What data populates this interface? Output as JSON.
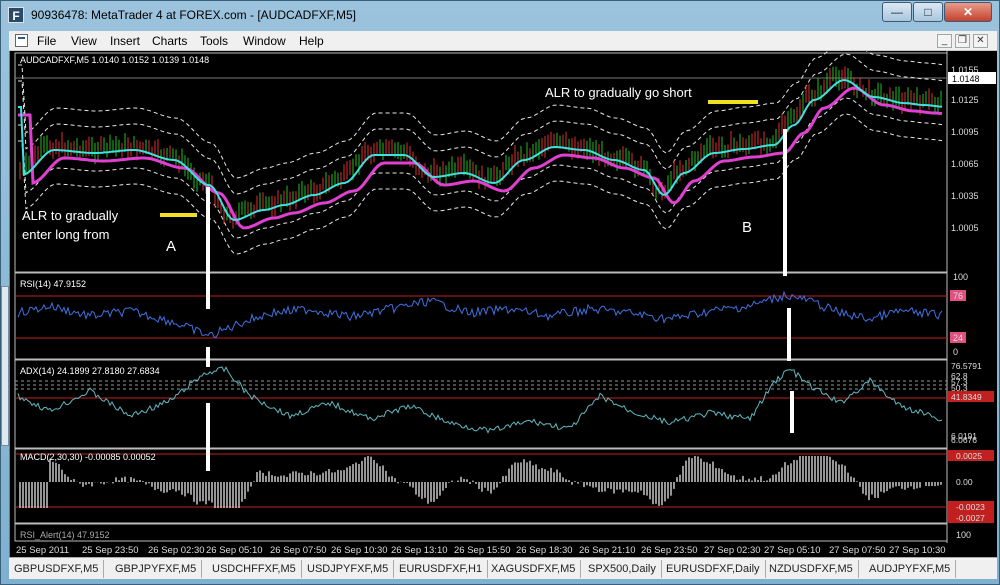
{
  "window": {
    "title": "90936478: MetaTrader 4 at FOREX.com - [AUDCADFXF,M5]",
    "app_icon_glyph": "F",
    "minimize_glyph": "—",
    "maximize_glyph": "□",
    "close_glyph": "✕"
  },
  "menu": {
    "items": [
      "File",
      "View",
      "Insert",
      "Charts",
      "Tools",
      "Window",
      "Help"
    ],
    "mdi_minimize": "_",
    "mdi_restore": "❐",
    "mdi_close": "✕"
  },
  "chart": {
    "main_header": "AUDCADFXF,M5  1.0140 1.0152 1.0139 1.0148",
    "current_price_label": "1.0148",
    "price_ticks": [
      "1.0155",
      "1.0125",
      "1.0095",
      "1.0065",
      "1.0035",
      "1.0005"
    ],
    "annotations": {
      "long_text_1": "ALR to gradually",
      "long_text_2": "enter long from",
      "short_text": "ALR to gradually go short",
      "label_a": "A",
      "label_b": "B"
    },
    "rsi": {
      "header": "RSI(14) 47.9152",
      "ticks": [
        "100",
        "76",
        "24",
        "0"
      ]
    },
    "adx": {
      "header": "ADX(14) 24.1899 27.8180 27.6834",
      "ticks": [
        "76.5791",
        "62.8",
        "57.3",
        "50.3",
        "41.8349",
        "6.0191",
        "6.0676"
      ]
    },
    "macd": {
      "header": "MACD(2,30,30) -0.00085 0.00052",
      "ticks": [
        "0.0025",
        "0.00",
        "-0.0023",
        "-0.0027"
      ]
    },
    "bottom_indicator": {
      "header": "RSI_Alert(14) 47.9152",
      "tick": "100"
    },
    "time_labels": [
      "25 Sep 2011",
      "25 Sep 23:50",
      "26 Sep 02:30",
      "26 Sep 05:10",
      "26 Sep 07:50",
      "26 Sep 10:30",
      "26 Sep 13:10",
      "26 Sep 15:50",
      "26 Sep 18:30",
      "26 Sep 21:10",
      "26 Sep 23:50",
      "27 Sep 02:30",
      "27 Sep 05:10",
      "27 Sep 07:50",
      "27 Sep 10:30"
    ]
  },
  "symbol_tabs": [
    "GBPUSDFXF,M5",
    "GBPJPYFXF,M5",
    "USDCHFFXF,M5",
    "USDJPYFXF,M5",
    "EURUSDFXF,H1",
    "XAGUSDFXF,M5",
    "SPX500,Daily",
    "EURUSDFXF,Daily",
    "NZDUSDFXF,M5",
    "AUDJPYFXF,M5"
  ],
  "active_tab": "AUDCADFXF,M5",
  "colors": {
    "ma_slow": "#e040d0",
    "ma_fast": "#40e0e0",
    "bands": "#e8e8e8",
    "bull_candle": "#20c020",
    "bear_candle": "#e03030",
    "rsi_line": "#4070e0",
    "adx_line": "#60b8c0",
    "macd_hist": "#c8c8c8",
    "level_line": "#c02020",
    "annotation_yellow": "#f0e020"
  }
}
